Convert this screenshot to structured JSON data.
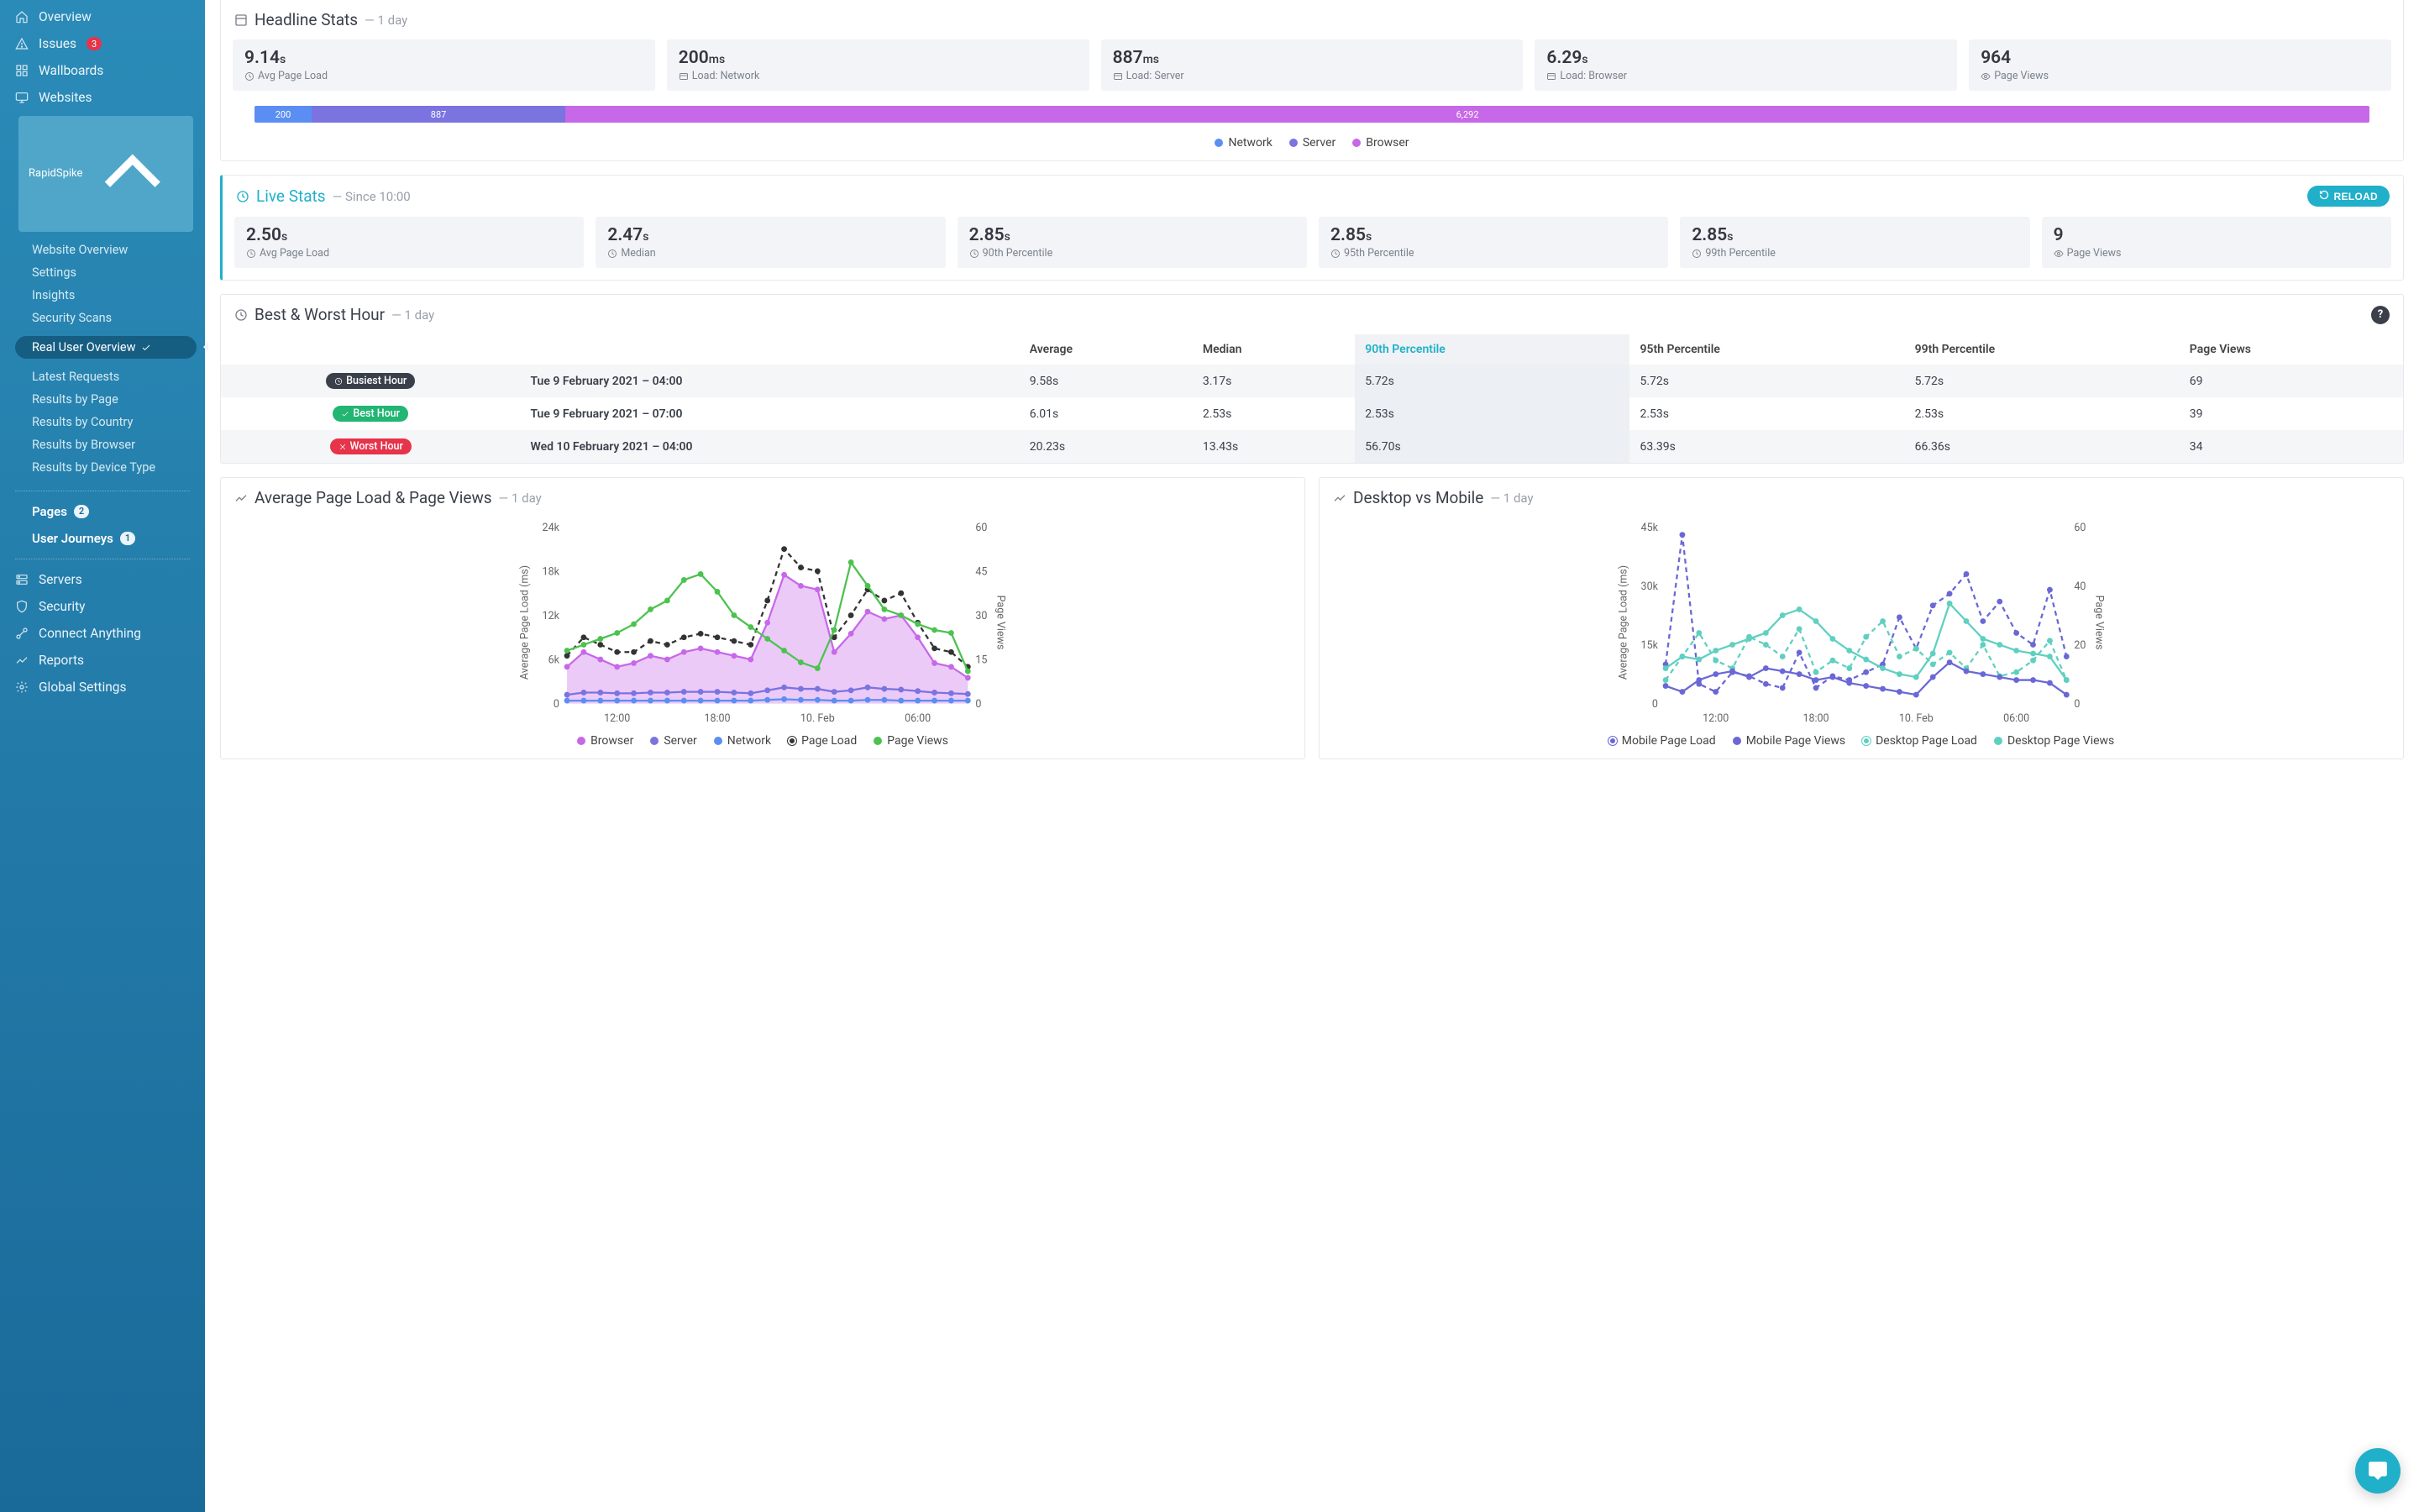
{
  "sidebar": {
    "nav": [
      {
        "icon": "home",
        "label": "Overview"
      },
      {
        "icon": "alert",
        "label": "Issues",
        "badge": "3",
        "badge_style": "red"
      },
      {
        "icon": "grid",
        "label": "Wallboards"
      },
      {
        "icon": "monitor",
        "label": "Websites"
      }
    ],
    "site_pill": "RapidSpike",
    "site_sub": [
      {
        "label": "Website Overview"
      },
      {
        "label": "Settings"
      },
      {
        "label": "Insights"
      },
      {
        "label": "Security Scans"
      }
    ],
    "active_sub": "Real User Overview",
    "rum_sub": [
      {
        "label": "Latest Requests"
      },
      {
        "label": "Results by Page"
      },
      {
        "label": "Results by Country"
      },
      {
        "label": "Results by Browser"
      },
      {
        "label": "Results by Device Type"
      }
    ],
    "sections": [
      {
        "label": "Pages",
        "badge": "2"
      },
      {
        "label": "User Journeys",
        "badge": "1"
      }
    ],
    "bottom": [
      {
        "icon": "server",
        "label": "Servers"
      },
      {
        "icon": "shield",
        "label": "Security"
      },
      {
        "icon": "plug",
        "label": "Connect Anything"
      },
      {
        "icon": "chart",
        "label": "Reports"
      },
      {
        "icon": "gear",
        "label": "Global Settings"
      }
    ]
  },
  "headline": {
    "title": "Headline Stats",
    "range": "— 1 day",
    "cards": [
      {
        "value": "9.14",
        "unit": "s",
        "label": "Avg Page Load",
        "icon": "clock"
      },
      {
        "value": "200",
        "unit": "ms",
        "label": "Load: Network",
        "icon": "load"
      },
      {
        "value": "887",
        "unit": "ms",
        "label": "Load: Server",
        "icon": "load"
      },
      {
        "value": "6.29",
        "unit": "s",
        "label": "Load: Browser",
        "icon": "load"
      },
      {
        "value": "964",
        "unit": "",
        "label": "Page Views",
        "icon": "eye"
      }
    ],
    "bar": {
      "network": {
        "w": 2.7,
        "label": "200"
      },
      "server": {
        "w": 12.0,
        "label": "887"
      },
      "browser": {
        "w": 85.3,
        "label": "6,292"
      }
    },
    "legend": [
      "Network",
      "Server",
      "Browser"
    ],
    "colors": {
      "network": "#5b8ef2",
      "server": "#7a73e0",
      "browser": "#c768e8"
    }
  },
  "live": {
    "title": "Live Stats",
    "since": "— Since 10:00",
    "reload": "RELOAD",
    "cards": [
      {
        "value": "2.50",
        "unit": "s",
        "label": "Avg Page Load",
        "icon": "clock"
      },
      {
        "value": "2.47",
        "unit": "s",
        "label": "Median",
        "icon": "clock"
      },
      {
        "value": "2.85",
        "unit": "s",
        "label": "90th Percentile",
        "icon": "clock"
      },
      {
        "value": "2.85",
        "unit": "s",
        "label": "95th Percentile",
        "icon": "clock"
      },
      {
        "value": "2.85",
        "unit": "s",
        "label": "99th Percentile",
        "icon": "clock"
      },
      {
        "value": "9",
        "unit": "",
        "label": "Page Views",
        "icon": "eye"
      }
    ]
  },
  "bestworst": {
    "title": "Best & Worst Hour",
    "range": "— 1 day",
    "cols": [
      "",
      "",
      "Average",
      "Median",
      "90th Percentile",
      "95th Percentile",
      "99th Percentile",
      "Page Views"
    ],
    "highlight_col": 4,
    "rows": [
      {
        "pill": "Busiest Hour",
        "pill_cls": "pill-busiest",
        "icon": "clock",
        "date": "Tue 9 February 2021 – 04:00",
        "vals": [
          "9.58s",
          "3.17s",
          "5.72s",
          "5.72s",
          "5.72s",
          "69"
        ]
      },
      {
        "pill": "Best Hour",
        "pill_cls": "pill-best",
        "icon": "check",
        "date": "Tue 9 February 2021 – 07:00",
        "vals": [
          "6.01s",
          "2.53s",
          "2.53s",
          "2.53s",
          "2.53s",
          "39"
        ]
      },
      {
        "pill": "Worst Hour",
        "pill_cls": "pill-worst",
        "icon": "x",
        "date": "Wed 10 February 2021 – 04:00",
        "vals": [
          "20.23s",
          "13.43s",
          "56.70s",
          "63.39s",
          "66.36s",
          "34"
        ]
      }
    ]
  },
  "chart1": {
    "title": "Average Page Load & Page Views",
    "range": "— 1 day",
    "legend": [
      {
        "name": "Browser",
        "color": "#c768e8"
      },
      {
        "name": "Server",
        "color": "#7a73e0"
      },
      {
        "name": "Network",
        "color": "#5b8ef2"
      },
      {
        "name": "Page Load",
        "color": "#333",
        "dash": true
      },
      {
        "name": "Page Views",
        "color": "#4cc24f"
      }
    ]
  },
  "chart2": {
    "title": "Desktop vs Mobile",
    "range": "— 1 day",
    "legend": [
      {
        "name": "Mobile Page Load",
        "color": "#6a67d6",
        "dash": true
      },
      {
        "name": "Mobile Page Views",
        "color": "#6a67d6"
      },
      {
        "name": "Desktop Page Load",
        "color": "#5fd0c0",
        "dash": true
      },
      {
        "name": "Desktop Page Views",
        "color": "#5fd0c0"
      }
    ]
  },
  "chart_data": [
    {
      "type": "bar",
      "title": "Headline load breakdown (ms)",
      "categories": [
        "Network",
        "Server",
        "Browser"
      ],
      "values": [
        200,
        887,
        6292
      ]
    },
    {
      "type": "line",
      "title": "Average Page Load & Page Views — 1 day",
      "xlabel": "",
      "yLeftLabel": "Average Page Load (ms)",
      "yRightLabel": "Page Views",
      "x_ticks": [
        "12:00",
        "18:00",
        "10. Feb",
        "06:00"
      ],
      "yLeft_ticks": [
        0,
        6000,
        12000,
        18000,
        24000
      ],
      "yRight_ticks": [
        0,
        15,
        30,
        45,
        60
      ],
      "x_hours": [
        9,
        10,
        11,
        12,
        13,
        14,
        15,
        16,
        17,
        18,
        19,
        20,
        21,
        22,
        23,
        24,
        25,
        26,
        27,
        28,
        29,
        30,
        31,
        32,
        33
      ],
      "series": [
        {
          "name": "Browser",
          "axis": "left",
          "color": "#c768e8",
          "area": true,
          "values": [
            5000,
            7000,
            6000,
            5000,
            5500,
            6500,
            6000,
            7000,
            7500,
            7000,
            6500,
            6000,
            11000,
            17500,
            16000,
            15500,
            7000,
            9500,
            12500,
            11500,
            12000,
            9000,
            5500,
            5000,
            3500
          ]
        },
        {
          "name": "Server",
          "axis": "left",
          "color": "#7a73e0",
          "values": [
            1200,
            1500,
            1500,
            1400,
            1400,
            1500,
            1500,
            1600,
            1600,
            1600,
            1500,
            1400,
            1800,
            2200,
            2000,
            2000,
            1600,
            1800,
            2200,
            2000,
            1900,
            1700,
            1500,
            1400,
            1300
          ]
        },
        {
          "name": "Network",
          "axis": "left",
          "color": "#5b8ef2",
          "values": [
            400,
            400,
            400,
            400,
            400,
            400,
            400,
            400,
            400,
            400,
            400,
            400,
            500,
            600,
            500,
            500,
            400,
            400,
            500,
            500,
            400,
            400,
            400,
            400,
            400
          ]
        },
        {
          "name": "Page Load",
          "axis": "left",
          "color": "#333333",
          "dash": true,
          "values": [
            6500,
            9000,
            8000,
            7000,
            7000,
            8500,
            8000,
            9000,
            9500,
            9000,
            8500,
            8000,
            14000,
            21000,
            18500,
            18000,
            9000,
            12000,
            15500,
            14000,
            15000,
            11000,
            7500,
            7000,
            5000
          ]
        },
        {
          "name": "Page Views",
          "axis": "right",
          "color": "#4cc24f",
          "values": [
            18,
            20,
            22,
            24,
            27,
            32,
            35,
            42,
            44,
            38,
            30,
            26,
            22,
            18,
            14,
            12,
            25,
            48,
            40,
            32,
            30,
            27,
            25,
            24,
            11
          ]
        }
      ]
    },
    {
      "type": "line",
      "title": "Desktop vs Mobile — 1 day",
      "xlabel": "",
      "yLeftLabel": "Average Page Load (ms)",
      "yRightLabel": "Page Views",
      "x_ticks": [
        "12:00",
        "18:00",
        "10. Feb",
        "06:00"
      ],
      "yLeft_ticks": [
        0,
        15000,
        30000,
        45000
      ],
      "yRight_ticks": [
        0,
        20,
        40,
        60
      ],
      "x_hours": [
        9,
        10,
        11,
        12,
        13,
        14,
        15,
        16,
        17,
        18,
        19,
        20,
        21,
        22,
        23,
        24,
        25,
        26,
        27,
        28,
        29,
        30,
        31,
        32,
        33
      ],
      "series": [
        {
          "name": "Mobile Page Load",
          "axis": "left",
          "color": "#6a67d6",
          "dash": true,
          "values": [
            10000,
            43000,
            5000,
            3000,
            8000,
            7000,
            5000,
            4000,
            13000,
            4000,
            7000,
            6000,
            8000,
            10000,
            22000,
            14000,
            25000,
            28000,
            33000,
            21000,
            26000,
            18000,
            15000,
            29000,
            12000
          ]
        },
        {
          "name": "Desktop Page Load",
          "axis": "left",
          "color": "#5fd0c0",
          "dash": true,
          "values": [
            6000,
            12000,
            18000,
            11000,
            9000,
            17000,
            15000,
            12000,
            19000,
            8000,
            11000,
            9000,
            17000,
            21000,
            12000,
            14000,
            10000,
            13000,
            9000,
            15000,
            7000,
            8000,
            11000,
            16000,
            6000
          ]
        },
        {
          "name": "Mobile Page Views",
          "axis": "right",
          "color": "#6a67d6",
          "values": [
            6,
            4,
            8,
            10,
            11,
            9,
            12,
            11,
            10,
            8,
            9,
            7,
            6,
            5,
            4,
            3,
            9,
            14,
            11,
            10,
            9,
            8,
            8,
            7,
            3
          ]
        },
        {
          "name": "Desktop Page Views",
          "axis": "right",
          "color": "#5fd0c0",
          "values": [
            12,
            16,
            15,
            18,
            20,
            22,
            24,
            30,
            32,
            28,
            22,
            18,
            15,
            12,
            10,
            9,
            17,
            34,
            28,
            22,
            20,
            18,
            17,
            16,
            8
          ]
        }
      ]
    }
  ]
}
